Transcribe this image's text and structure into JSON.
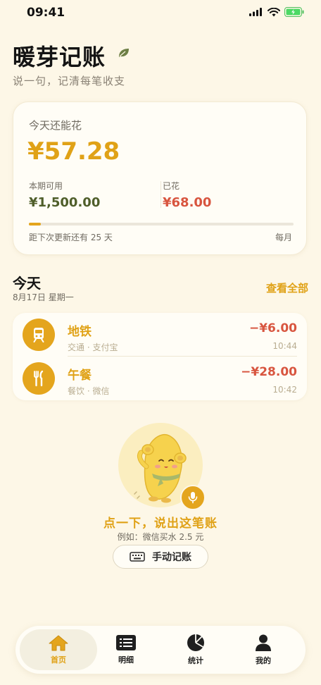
{
  "status_bar": {
    "time": "09:41"
  },
  "header": {
    "title": "暖芽记账",
    "subtitle": "说一句，记清每笔收支"
  },
  "budget": {
    "remain_label": "今天还能花",
    "remain_value": "¥57.28",
    "available_label": "本期可用",
    "available_value": "¥1,500.00",
    "spent_label": "已花",
    "spent_value": "¥68.00",
    "progress_fraction": 0.045,
    "refresh_text": "距下次更新还有 25 天",
    "period": "每月"
  },
  "today": {
    "title": "今天",
    "date": "8月17日 星期一",
    "see_all": "查看全部",
    "items": [
      {
        "name": "地铁",
        "meta": "交通 · 支付宝",
        "amount": "−¥6.00",
        "time": "10:44",
        "icon": "train-icon"
      },
      {
        "name": "午餐",
        "meta": "餐饮 · 微信",
        "amount": "−¥28.00",
        "time": "10:42",
        "icon": "utensils-icon"
      }
    ]
  },
  "voice": {
    "prompt": "点一下，说出这笔账",
    "example": "例如：微信买水 2.5 元",
    "manual_button": "手动记账"
  },
  "tabbar": {
    "tabs": [
      {
        "label": "首页",
        "icon": "home-icon",
        "active": true
      },
      {
        "label": "明细",
        "icon": "list-icon",
        "active": false
      },
      {
        "label": "统计",
        "icon": "pie-chart-icon",
        "active": false
      },
      {
        "label": "我的",
        "icon": "user-icon",
        "active": false
      }
    ]
  },
  "colors": {
    "background": "#fdf7e7",
    "accent": "#e4a51d",
    "expense": "#d8553f",
    "available": "#4f5e2a"
  }
}
